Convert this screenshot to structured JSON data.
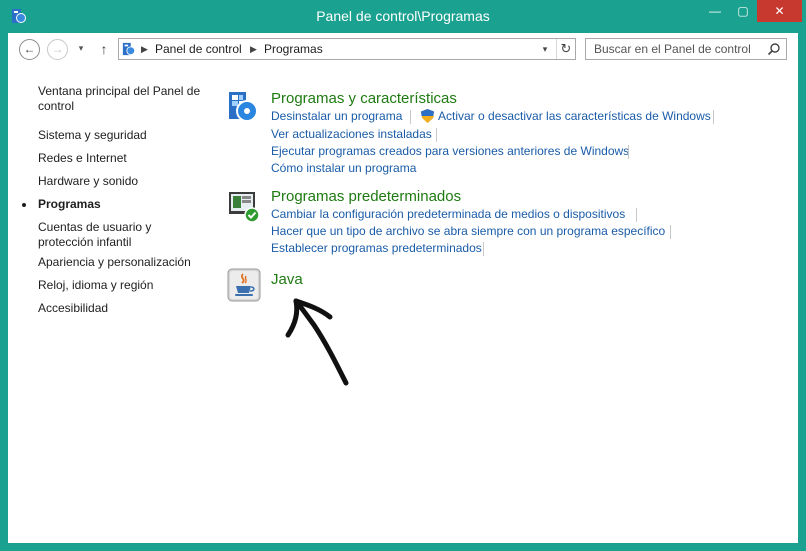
{
  "window": {
    "title": "Panel de control\\Programas",
    "minimize_glyph": "—",
    "maximize_glyph": "▢",
    "close_glyph": "✕"
  },
  "nav": {
    "back_glyph": "←",
    "forward_glyph": "→",
    "recent_glyph": "▾",
    "up_glyph": "↑",
    "breadcrumb": [
      "Panel de control",
      "Programas"
    ],
    "dropdown_glyph": "▾",
    "refresh_glyph": "↻"
  },
  "search": {
    "placeholder": "Buscar en el Panel de control"
  },
  "sidebar": {
    "items": [
      {
        "label": "Ventana principal del Panel de control"
      },
      {
        "label": "Sistema y seguridad"
      },
      {
        "label": "Redes e Internet"
      },
      {
        "label": "Hardware y sonido"
      },
      {
        "label": "Programas"
      },
      {
        "label": "Cuentas de usuario y protección infantil"
      },
      {
        "label": "Apariencia y personalización"
      },
      {
        "label": "Reloj, idioma y región"
      },
      {
        "label": "Accesibilidad"
      }
    ],
    "active_index": 4
  },
  "categories": [
    {
      "title": "Programas y características",
      "icon": "programs-features-icon",
      "links": [
        "Desinstalar un programa",
        "Activar o desactivar las características de Windows",
        "Ver actualizaciones instaladas",
        "Ejecutar programas creados para versiones anteriores de Windows",
        "Cómo instalar un programa"
      ]
    },
    {
      "title": "Programas predeterminados",
      "icon": "default-programs-icon",
      "links": [
        "Cambiar la configuración predeterminada de medios o dispositivos",
        "Hacer que un tipo de archivo se abra siempre con un programa específico",
        "Establecer programas predeterminados"
      ]
    },
    {
      "title": "Java",
      "icon": "java-icon",
      "links": []
    }
  ],
  "colors": {
    "frame": "#1aa190",
    "close_button": "#c7392f",
    "category_title": "#1e7b11",
    "link": "#1a5ca8"
  }
}
